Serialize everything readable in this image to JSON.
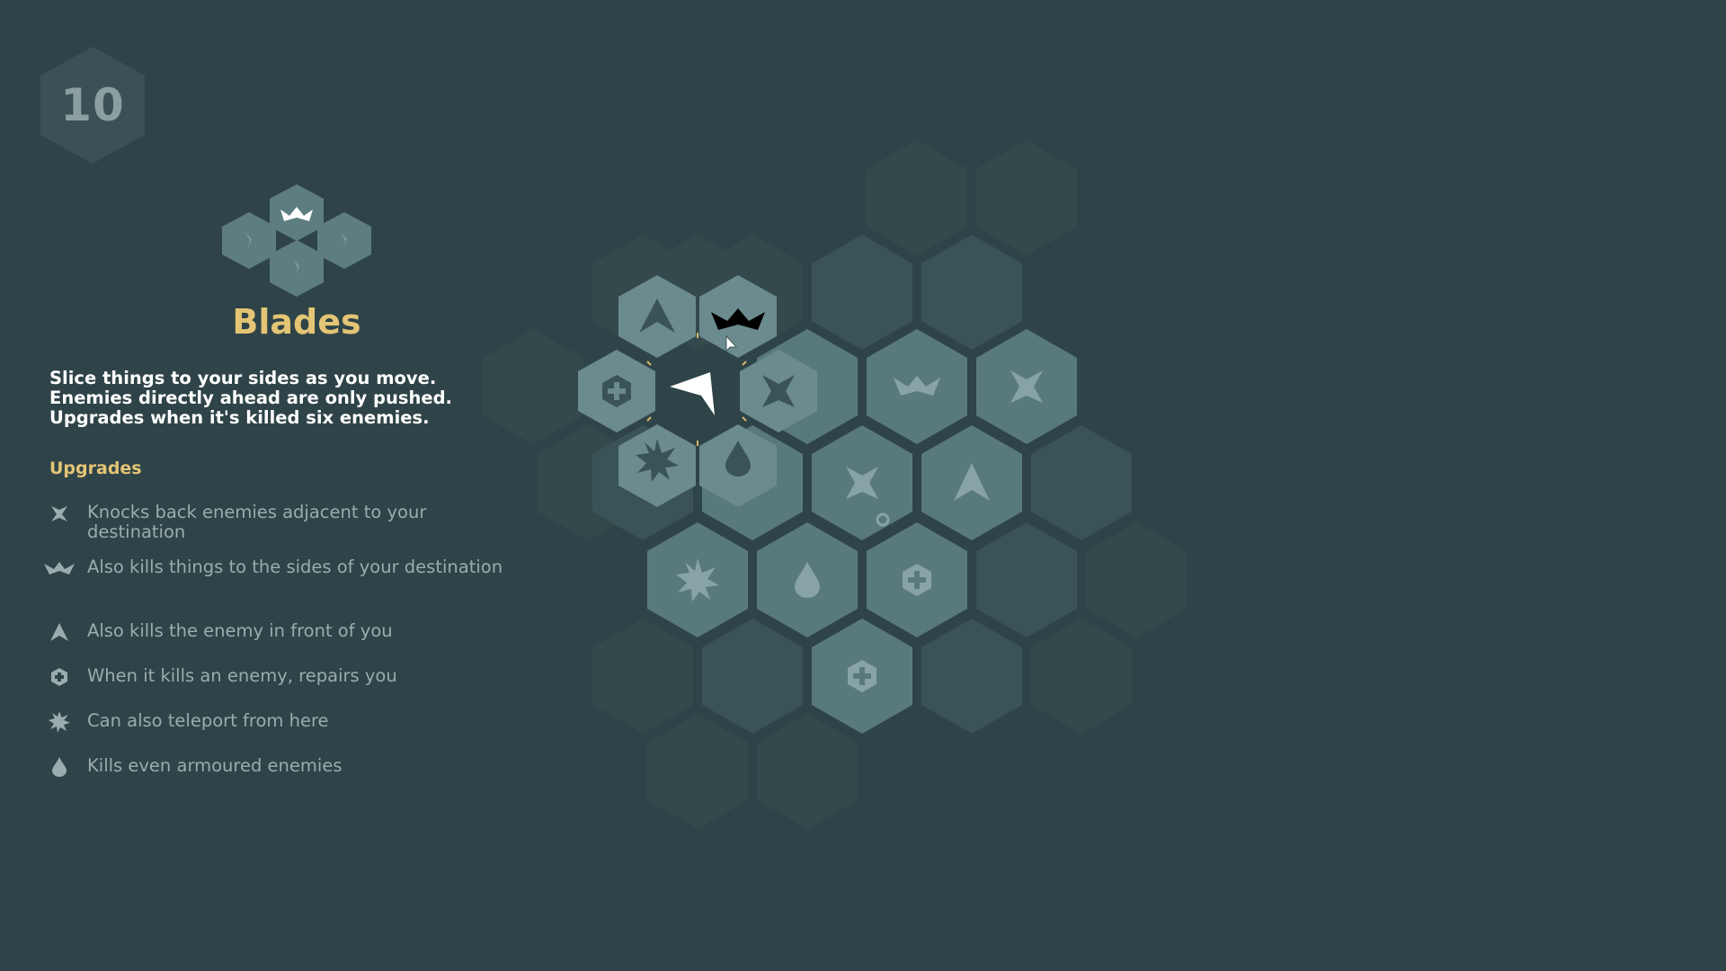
{
  "level": {
    "number": "10"
  },
  "weapon": {
    "name": "Blades",
    "description": [
      "Slice things to your sides as you move.",
      "Enemies directly ahead are only pushed.",
      "Upgrades when it's killed six enemies."
    ]
  },
  "upgrades": {
    "title": "Upgrades",
    "items": [
      {
        "icon": "knockback-icon",
        "text": "Knocks back enemies adjacent to your destination"
      },
      {
        "icon": "side-blades-icon",
        "text": "Also kills things to the sides of your destination"
      },
      {
        "icon": "spear-icon",
        "text": "Also kills the enemy in front of you"
      },
      {
        "icon": "repair-icon",
        "text": "When it kills an enemy, repairs you"
      },
      {
        "icon": "teleport-burst-icon",
        "text": "Can also teleport from here"
      },
      {
        "icon": "drop-icon",
        "text": "Kills even armoured enemies"
      }
    ]
  },
  "colors": {
    "background": "#2f4448",
    "accent_gold": "#e4c475",
    "tile_light": "#6b8b8e",
    "tile_dark": "#3a5356",
    "text_muted": "#9aacae"
  }
}
